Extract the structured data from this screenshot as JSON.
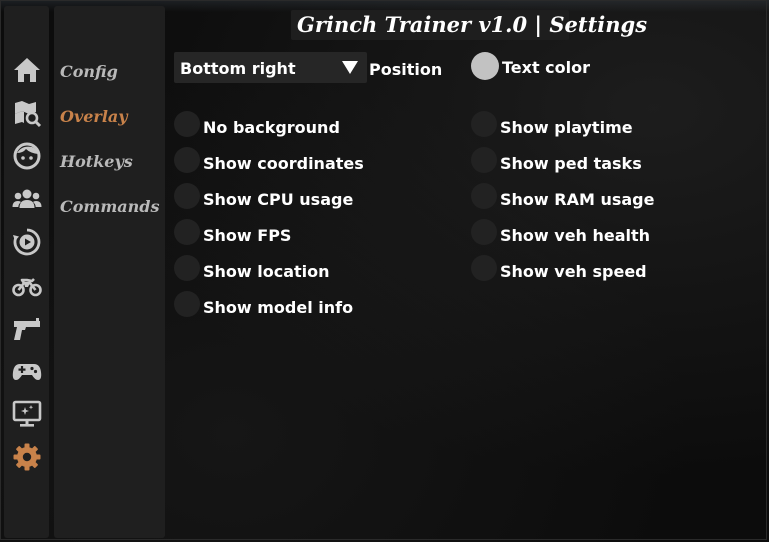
{
  "window": {
    "title": "Grinch Trainer v1.0 | Settings"
  },
  "sidebar_icons": [
    {
      "name": "home-icon"
    },
    {
      "name": "map-search-icon"
    },
    {
      "name": "player-face-icon"
    },
    {
      "name": "peds-group-icon"
    },
    {
      "name": "replay-icon"
    },
    {
      "name": "motorcycle-icon"
    },
    {
      "name": "pistol-icon"
    },
    {
      "name": "gamepad-icon"
    },
    {
      "name": "display-sparkle-icon"
    },
    {
      "name": "gear-icon",
      "active": true
    }
  ],
  "categories": [
    {
      "label": "Config",
      "active": false
    },
    {
      "label": "Overlay",
      "active": true
    },
    {
      "label": "Hotkeys",
      "active": false
    },
    {
      "label": "Commands",
      "active": false
    }
  ],
  "overlay": {
    "position_select": {
      "value": "Bottom right",
      "label": "Position"
    },
    "text_color": {
      "label": "Text color",
      "color": "#c2c2c2"
    },
    "left_options": [
      {
        "label": "No background",
        "checked": false
      },
      {
        "label": "Show coordinates",
        "checked": false
      },
      {
        "label": "Show CPU usage",
        "checked": false
      },
      {
        "label": "Show FPS",
        "checked": false
      },
      {
        "label": "Show location",
        "checked": false
      },
      {
        "label": "Show model info",
        "checked": false
      }
    ],
    "right_options": [
      {
        "label": "Show playtime",
        "checked": false
      },
      {
        "label": "Show ped tasks",
        "checked": false
      },
      {
        "label": "Show RAM usage",
        "checked": false
      },
      {
        "label": "Show veh health",
        "checked": false
      },
      {
        "label": "Show veh speed",
        "checked": false
      }
    ]
  },
  "colors": {
    "accent": "#c8824a",
    "panel": "#1f1f1f",
    "icon_default": "#c8c8c8",
    "toggle_off": "#222222"
  }
}
